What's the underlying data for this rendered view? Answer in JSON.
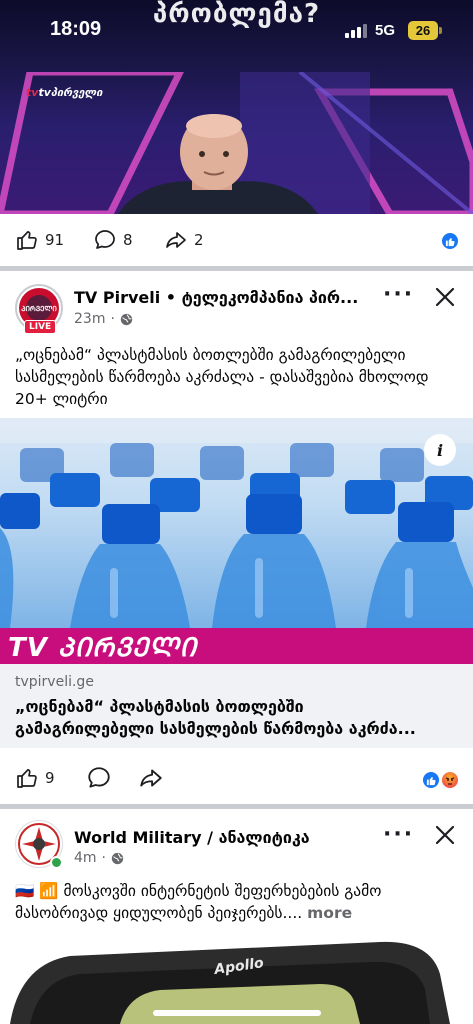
{
  "status_bar": {
    "time": "18:09",
    "network": "5G",
    "battery": "26"
  },
  "top_post": {
    "banner_text": "პრობლემა?",
    "channel_logo": "tvპირველი",
    "reactions": {
      "likes": "91",
      "comments": "8",
      "shares": "2"
    }
  },
  "post1": {
    "page_name": "TV Pirveli • ტელეკომპანია პირ...",
    "live_label": "LIVE",
    "time": "23m",
    "privacy_icon": "globe-icon",
    "text": "„ოცნებამ“ პლასტმასის ბოთლებში გამაგრილებელი სასმელების წარმოება აკრძალა - დასაშვებია მხოლოდ 20+ ლიტრი",
    "brand_band": "TV ᲞᲘᲠᲕᲔᲚᲘ",
    "link_domain": "tvpirveli.ge",
    "link_title_line1": "„ოცნებამ“ პლასტმასის ბოთლებში",
    "link_title_line2": "გამაგრილებელი სასმელების წარმოება აკრძა...",
    "reactions": {
      "likes": "9"
    }
  },
  "post2": {
    "page_name": "World Military / ანალიტიკა",
    "time": "4m",
    "privacy_icon": "globe-icon",
    "text_line1": "🇷🇺 📶 მოსკოვში ინტერნეტის შეფერხებების გამო",
    "text_line2": "მასობრივად ყიდულობენ პეიჯერებს....",
    "more_label": "more"
  },
  "colors": {
    "accent": "#1877f2",
    "brand_band": "#c80d7c",
    "divider": "#c9ccd1",
    "secondary_text": "#65676b"
  }
}
